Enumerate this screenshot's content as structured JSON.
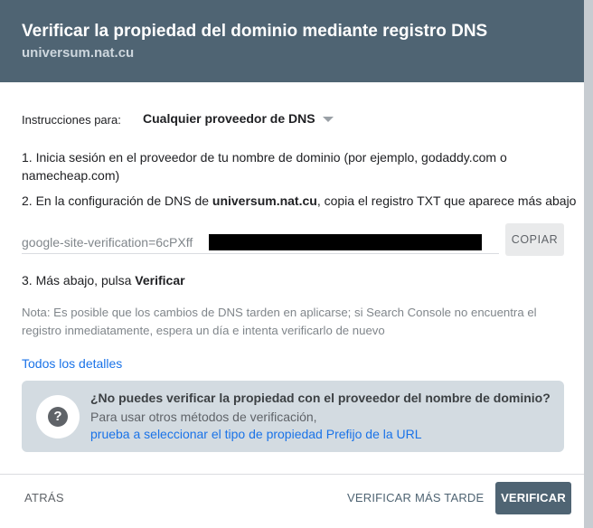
{
  "header": {
    "title": "Verificar la propiedad del dominio mediante registro DNS",
    "subtitle": "universum.nat.cu"
  },
  "instructions": {
    "label": "Instrucciones para:",
    "provider_value": "Cualquier proveedor de DNS"
  },
  "steps": {
    "step1": "1. Inicia sesión en el proveedor de tu nombre de dominio (por ejemplo, godaddy.com o namecheap.com)",
    "step2_prefix": "2. En la configuración de DNS de ",
    "step2_domain": "universum.nat.cu",
    "step2_suffix": ", copia el registro TXT que aparece más abajo",
    "step3_prefix": "3. Más abajo, pulsa ",
    "step3_action": "Verificar"
  },
  "txt_record": {
    "value": "google-site-verification=6cPXff",
    "copy_label": "COPIAR"
  },
  "note": "Nota: Es posible que los cambios de DNS tarden en aplicarse; si Search Console no encuentra el registro inmediatamente, espera un día e intenta verificarlo de nuevo",
  "details_link": "Todos los detalles",
  "infobox": {
    "icon": "help-icon",
    "title": "¿No puedes verificar la propiedad con el proveedor del nombre de dominio?",
    "text": "Para usar otros métodos de verificación,",
    "link": "prueba a seleccionar el tipo de propiedad Prefijo de la URL"
  },
  "footer": {
    "back_label": "ATRÁS",
    "later_label": "VERIFICAR MÁS TARDE",
    "verify_label": "VERIFICAR"
  },
  "colors": {
    "header_bg": "#4f6473",
    "link": "#1a73e8",
    "infobox_bg": "#d3dbe1"
  }
}
